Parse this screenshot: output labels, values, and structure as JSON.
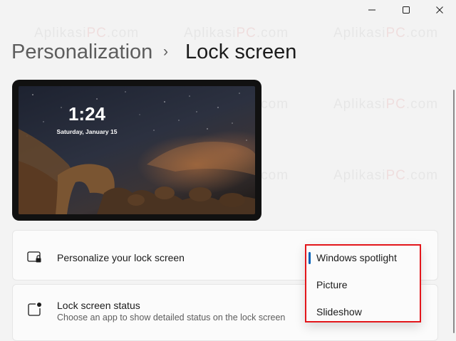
{
  "window_controls": {
    "minimize_icon": "minimize-icon",
    "maximize_icon": "maximize-icon",
    "close_icon": "close-icon"
  },
  "breadcrumb": {
    "parent": "Personalization",
    "separator": "›",
    "current": "Lock screen"
  },
  "preview": {
    "time": "1:24",
    "date": "Saturday, January 15"
  },
  "settings": {
    "personalize": {
      "label": "Personalize your lock screen",
      "icon": "lock-screen-icon"
    },
    "status": {
      "label": "Lock screen status",
      "description": "Choose an app to show detailed status on the lock screen",
      "icon": "lock-screen-status-icon"
    }
  },
  "dropdown": {
    "options": [
      "Windows spotlight",
      "Picture",
      "Slideshow"
    ],
    "selected": "Windows spotlight",
    "accent_color": "#005fb8",
    "highlight_border_color": "#e3161b"
  },
  "watermark": {
    "prefix": "Aplikasi",
    "highlight": "PC",
    "suffix": ".com"
  }
}
